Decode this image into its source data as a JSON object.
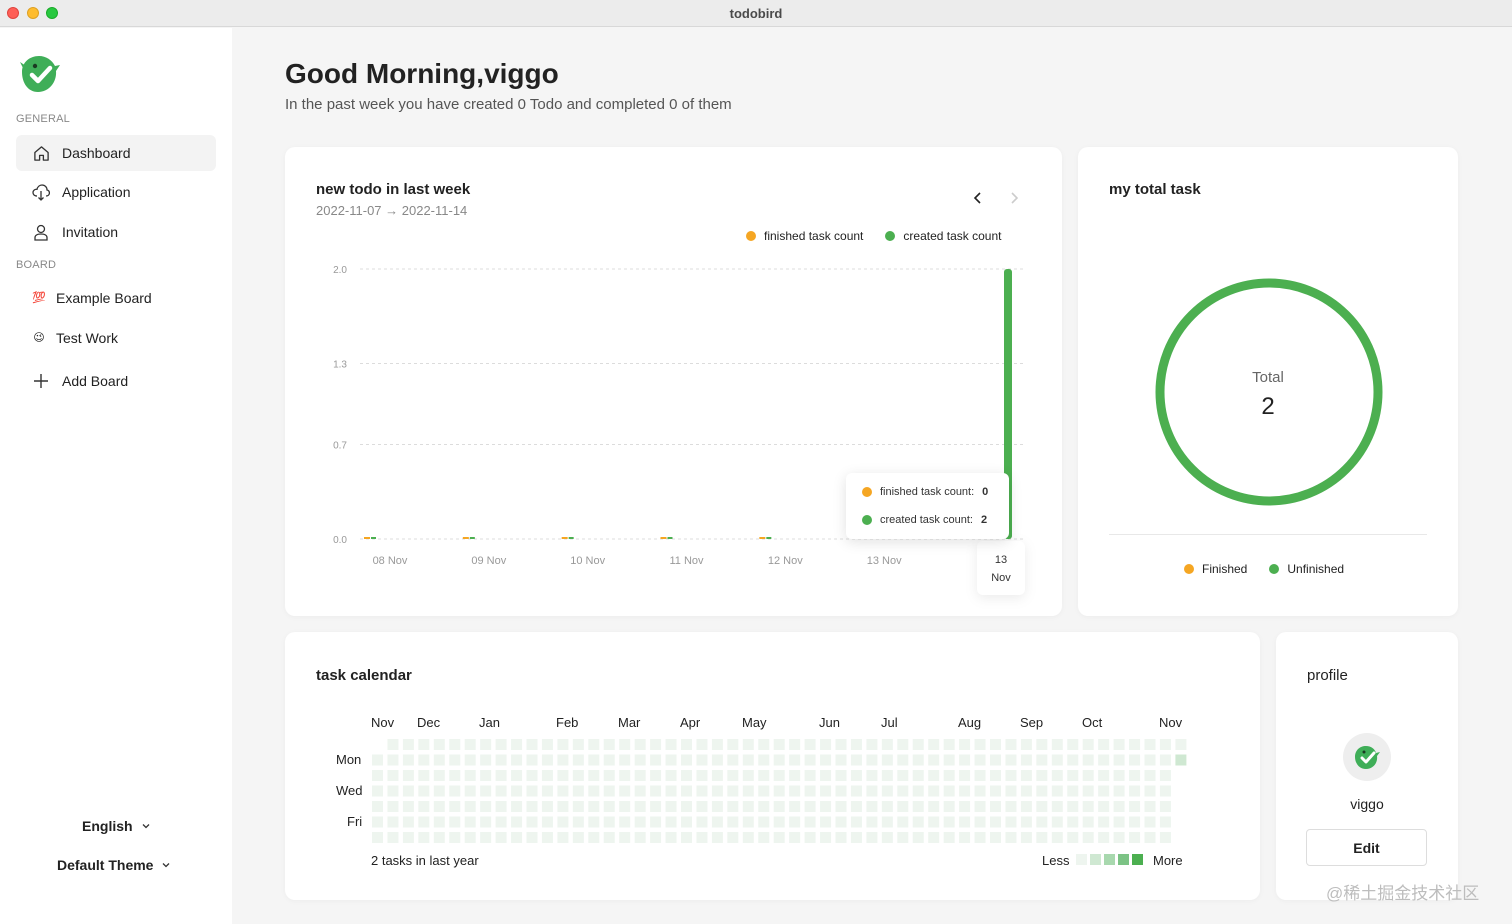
{
  "window": {
    "title": "todobird"
  },
  "sidebar": {
    "general_label": "GENERAL",
    "nav": [
      {
        "label": "Dashboard",
        "icon": "home-icon"
      },
      {
        "label": "Application",
        "icon": "cloud-icon"
      },
      {
        "label": "Invitation",
        "icon": "user-icon"
      }
    ],
    "board_label": "BOARD",
    "boards": [
      {
        "label": "Example Board",
        "emoji": "💯"
      },
      {
        "label": "Test Work",
        "emoji": "😉"
      }
    ],
    "add_board_label": "Add Board",
    "language": "English",
    "theme": "Default Theme"
  },
  "header": {
    "greeting": "Good Morning,viggo",
    "summary": "In the past week you have created 0 Todo and completed 0 of them"
  },
  "weekly_card": {
    "title": "new todo in last week",
    "date_range": "2022-11-07 → 2022-11-14",
    "tooltip": {
      "finished_label": "finished task count:",
      "finished_value": "0",
      "created_label": "created task count:",
      "created_value": "2"
    }
  },
  "chart_data": {
    "type": "bar",
    "title": "",
    "xlabel": "",
    "ylabel": "",
    "categories": [
      "08 Nov",
      "09 Nov",
      "10 Nov",
      "11 Nov",
      "12 Nov",
      "13 Nov",
      "13 Nov"
    ],
    "series": [
      {
        "name": "finished task count",
        "color": "#f5a623",
        "values": [
          0,
          0,
          0,
          0,
          0,
          0,
          0
        ]
      },
      {
        "name": "created task count",
        "color": "#4caf50",
        "values": [
          0,
          0,
          0,
          0,
          0,
          0,
          2
        ]
      }
    ],
    "yticks": [
      "0.0",
      "0.7",
      "1.3",
      "2.0"
    ],
    "ylim": [
      0,
      2
    ],
    "legend_position": "top-right",
    "grid": true
  },
  "total_card": {
    "title": "my total task",
    "total_label": "Total",
    "total_value": "2",
    "finished_label": "Finished",
    "unfinished_label": "Unfinished",
    "finished_color": "#f5a623",
    "unfinished_color": "#4caf50"
  },
  "calendar_card": {
    "title": "task calendar",
    "months": [
      "Nov",
      "Dec",
      "Jan",
      "Feb",
      "Mar",
      "Apr",
      "May",
      "Jun",
      "Jul",
      "Aug",
      "Sep",
      "Oct",
      "Nov"
    ],
    "days": [
      "Mon",
      "Wed",
      "Fri"
    ],
    "summary": "2 tasks in last year",
    "less_label": "Less",
    "more_label": "More",
    "active_cell": {
      "week": 52,
      "day": 1,
      "count": 2
    }
  },
  "profile_card": {
    "title": "profile",
    "username": "viggo",
    "edit_label": "Edit"
  },
  "watermark": "@稀土掘金技术社区"
}
